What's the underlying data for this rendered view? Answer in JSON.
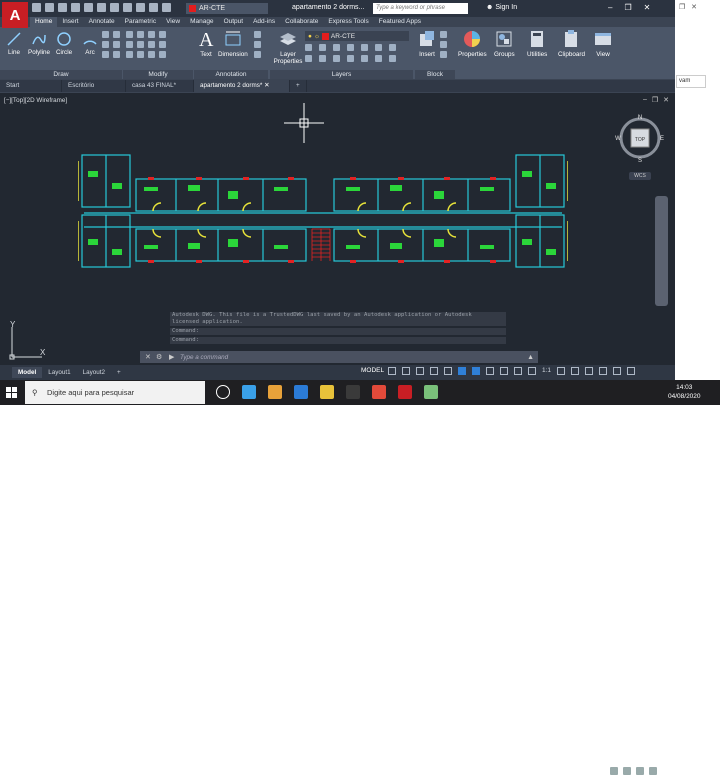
{
  "titlebar": {
    "app_logo": "A",
    "layer_name": "AR-CTE",
    "doc_title": "apartamento 2 dorms...",
    "search_placeholder": "Type a keyword or phrase",
    "signin": "Sign In"
  },
  "ribbon_tabs": [
    "Home",
    "Insert",
    "Annotate",
    "Parametric",
    "View",
    "Manage",
    "Output",
    "Add-ins",
    "Collaborate",
    "Express Tools",
    "Featured Apps"
  ],
  "ribbon": {
    "draw_tools": [
      "Line",
      "Polyline",
      "Circle",
      "Arc"
    ],
    "panels": {
      "draw": "Draw",
      "modify": "Modify",
      "annotation": "Annotation",
      "layers": "Layers",
      "block": "Block"
    },
    "text": "Text",
    "dimension": "Dimension",
    "layer_properties": "Layer Properties",
    "layer_current": "AR-CTE",
    "insert": "Insert",
    "properties": "Properties",
    "groups": "Groups",
    "utilities": "Utilities",
    "clipboard": "Clipboard",
    "view": "View"
  },
  "file_tabs": [
    "Start",
    "Escritório",
    "casa 43 FINAL*",
    "apartamento 2 dorms*"
  ],
  "viewport": {
    "label": "[−][Top][2D Wireframe]",
    "viewcube": {
      "top": "TOP",
      "n": "N",
      "s": "S",
      "e": "E",
      "w": "W"
    },
    "wcs": "WCS",
    "ucs_x": "X",
    "ucs_y": "Y"
  },
  "command": {
    "history": [
      "Autodesk DWG.  This file is a TrustedDWG last saved by an Autodesk application or Autodesk",
      "licensed application.",
      "Command:",
      "Command:"
    ],
    "placeholder": "Type a command"
  },
  "statusbar": {
    "tabs": [
      "Model",
      "Layout1",
      "Layout2"
    ],
    "model": "MODEL",
    "scale": "1:1"
  },
  "taskbar": {
    "search_placeholder": "Digite aqui para pesquisar",
    "time": "14:03",
    "date": "04/08/2020",
    "app_colors": [
      "#ffffff",
      "#3aa0e8",
      "#e8a23a",
      "#2b7bd6",
      "#e8c23a",
      "#3a3a3a",
      "#e24a3a",
      "#c81e24",
      "#7ac07a"
    ]
  },
  "right_strip": {
    "snippet": "vam"
  },
  "colors": {
    "accent": "#c81e24",
    "drawing_cyan": "#27c8d8",
    "drawing_green": "#2bd63a",
    "drawing_yellow": "#e8e33a",
    "drawing_red": "#e32222"
  }
}
